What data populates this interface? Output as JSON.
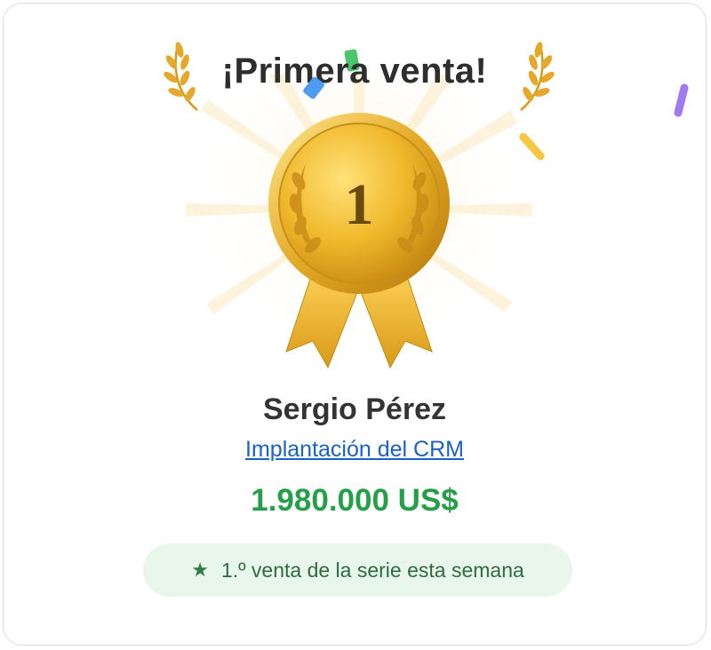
{
  "card": {
    "title": "¡Primera venta!",
    "medal_number": "1",
    "rep_name": "Sergio Pérez",
    "deal_name": "Implantación del CRM",
    "amount": "1.980.000 US$",
    "badge_text": "1.º venta de la serie esta semana",
    "badge_icon": "star-icon"
  },
  "colors": {
    "amount": "#25a049",
    "link": "#1a62c4",
    "badge_bg": "#e9f6ec",
    "gold": "#e8b526",
    "confetti": [
      "#4cc46a",
      "#4e9cf0",
      "#a27af0",
      "#f5c842"
    ]
  }
}
